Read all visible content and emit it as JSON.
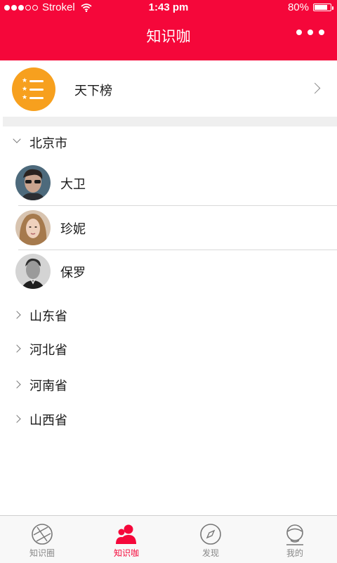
{
  "status_bar": {
    "carrier": "Strokel",
    "time": "1:43 pm",
    "battery": "80%",
    "battery_level": 0.8
  },
  "nav": {
    "title": "知识咖"
  },
  "ranking": {
    "label": "天下榜"
  },
  "regions": {
    "expanded": {
      "label": "北京市",
      "contacts": [
        {
          "name": "大卫"
        },
        {
          "name": "珍妮"
        },
        {
          "name": "保罗"
        }
      ]
    },
    "collapsed": [
      {
        "label": "山东省"
      },
      {
        "label": "河北省"
      },
      {
        "label": "河南省"
      },
      {
        "label": "山西省"
      }
    ]
  },
  "tabbar": {
    "tabs": [
      {
        "label": "知识圈",
        "icon": "aperture-icon"
      },
      {
        "label": "知识咖",
        "icon": "people-icon"
      },
      {
        "label": "发现",
        "icon": "compass-icon"
      },
      {
        "label": "我的",
        "icon": "profile-icon"
      }
    ],
    "active_color": "#f5073a"
  },
  "colors": {
    "brand": "#f5073a",
    "ranking_badge": "#f7a01e"
  }
}
